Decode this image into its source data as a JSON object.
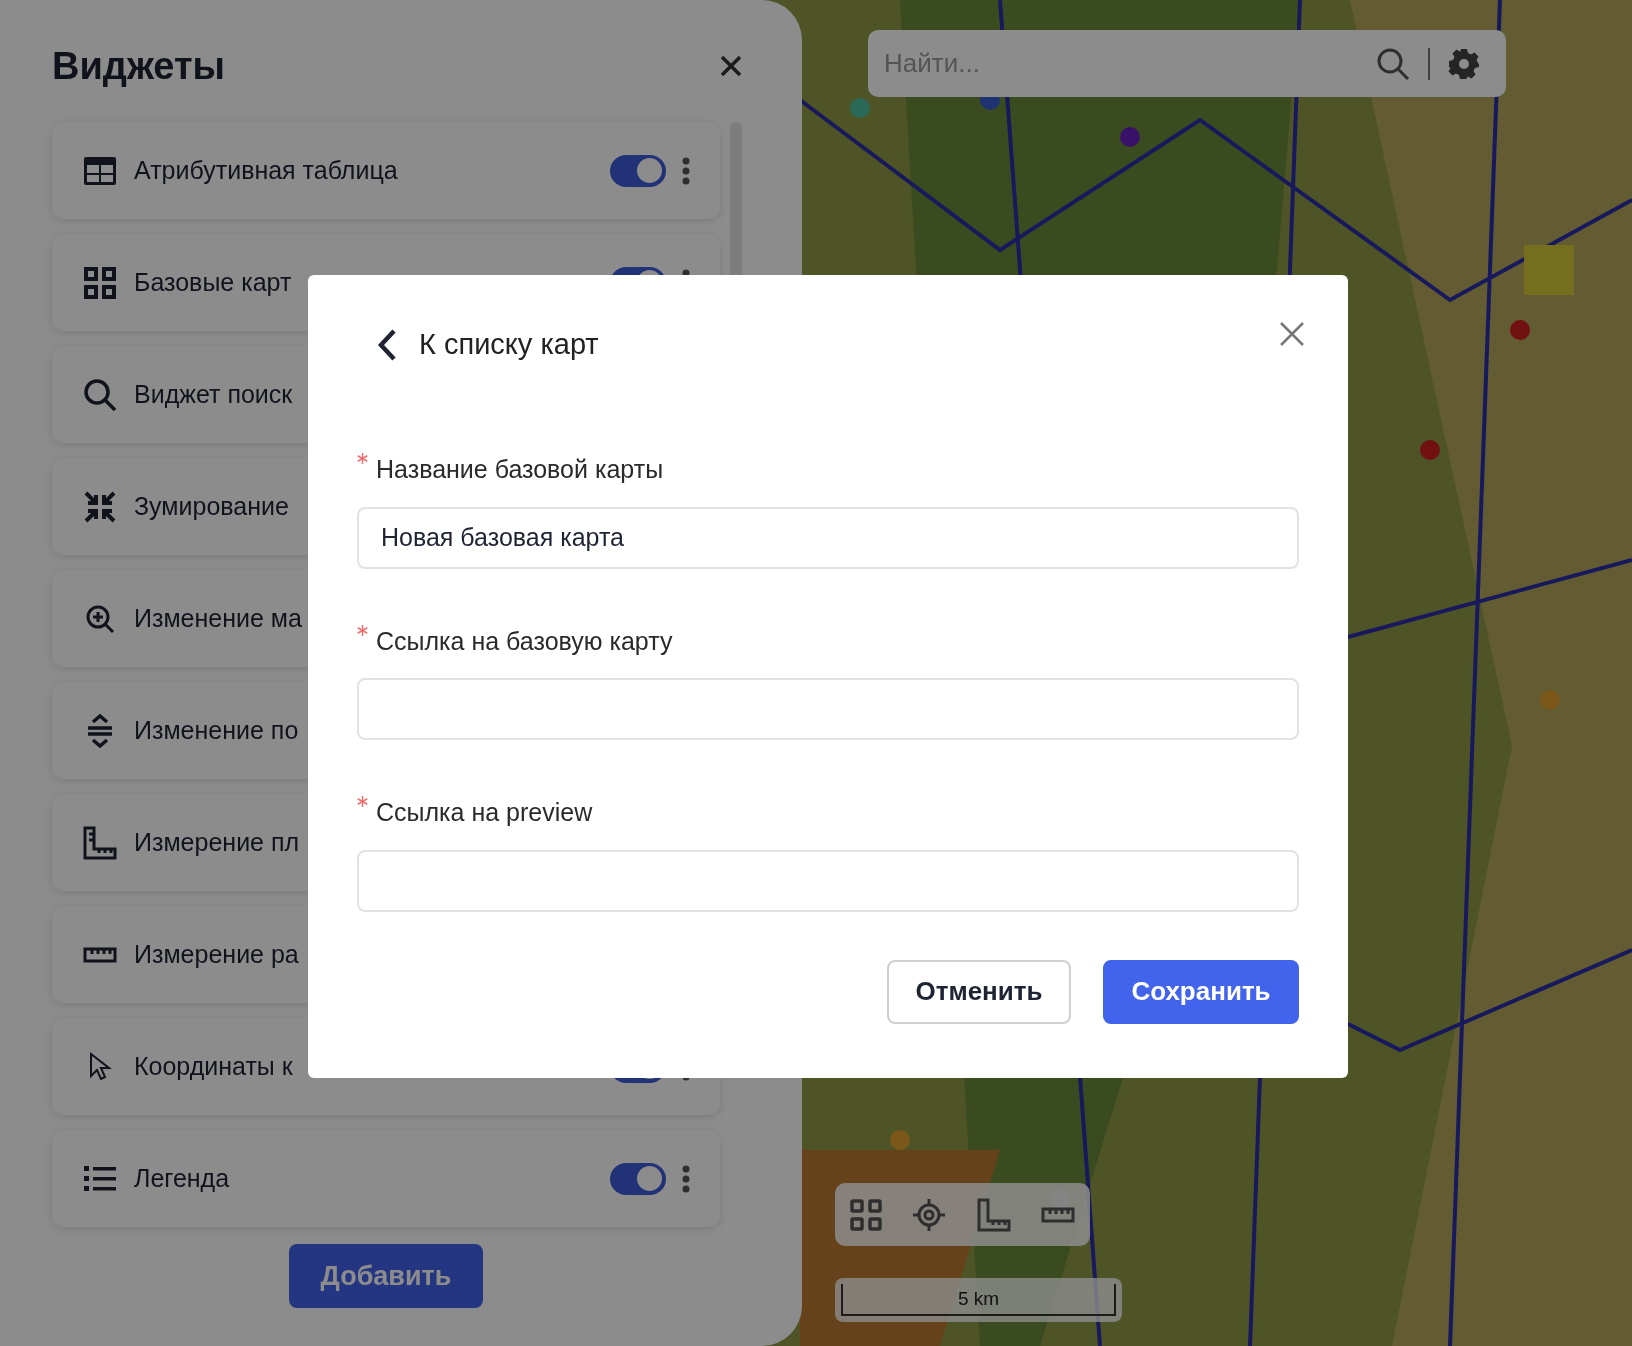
{
  "widgets_panel": {
    "title": "Виджеты",
    "items": [
      {
        "label": "Атрибутивная таблица",
        "on": true
      },
      {
        "label": "Базовые карт",
        "on": true
      },
      {
        "label": "Виджет поиск"
      },
      {
        "label": "Зумирование"
      },
      {
        "label": "Изменение ма"
      },
      {
        "label": "Изменение по"
      },
      {
        "label": "Измерение пл"
      },
      {
        "label": "Измерение ра"
      },
      {
        "label": "Координаты к",
        "on": true
      },
      {
        "label": "Легенда",
        "on": true
      }
    ],
    "add_button": "Добавить"
  },
  "map": {
    "search": {
      "placeholder": "Найти..."
    },
    "scale": "5 km"
  },
  "dialog": {
    "back": "К списку карт",
    "fields": [
      {
        "label": "Название базовой карты",
        "required": true,
        "value": "Новая базовая карта"
      },
      {
        "label": "Ссылка на базовую карту",
        "required": true
      },
      {
        "label": "Ссылка на preview",
        "required": true
      }
    ],
    "buttons": [
      {
        "label": "Отменить",
        "kind": "secondary"
      },
      {
        "label": "Сохранить",
        "kind": "primary"
      }
    ]
  }
}
